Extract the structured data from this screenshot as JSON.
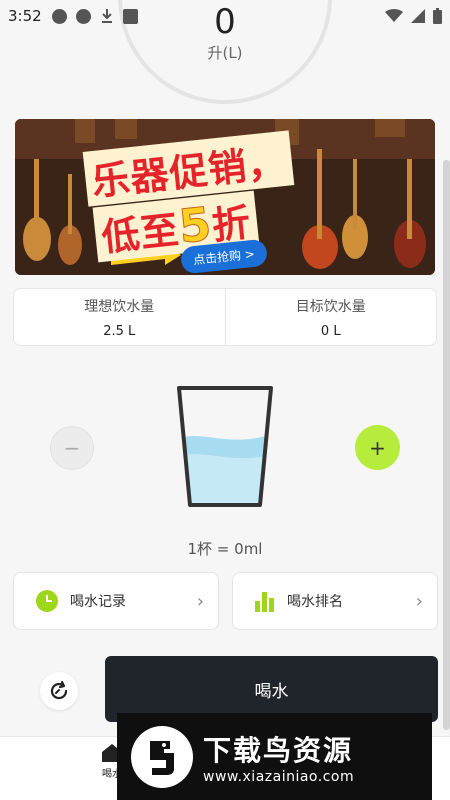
{
  "status_bar": {
    "time": "3:52"
  },
  "gauge": {
    "value": "0",
    "unit": "升(L)"
  },
  "banner": {
    "line1": "乐器促销，",
    "line2_prefix": "低至",
    "line2_number": "5",
    "line2_suffix": "折",
    "cta": "点击抢购 >"
  },
  "stats": [
    {
      "label": "理想饮水量",
      "value": "2.5 L"
    },
    {
      "label": "目标饮水量",
      "value": "0 L"
    }
  ],
  "controls": {
    "minus": "−",
    "plus": "+"
  },
  "cup": {
    "caption": "1杯 = 0ml",
    "fill_level": 0.55
  },
  "actions": {
    "record_label": "喝水记录",
    "ranking_label": "喝水排名",
    "chevron": "›"
  },
  "drink_button": {
    "label": "喝水"
  },
  "bottom_nav": {
    "item_label": "喝水"
  },
  "watermark": {
    "title": "下载鸟资源",
    "url": "www.xiazainiao.com"
  },
  "colors": {
    "accent": "#b6ec3c",
    "dark_button": "#20242b",
    "water": "#a8dcf0"
  }
}
